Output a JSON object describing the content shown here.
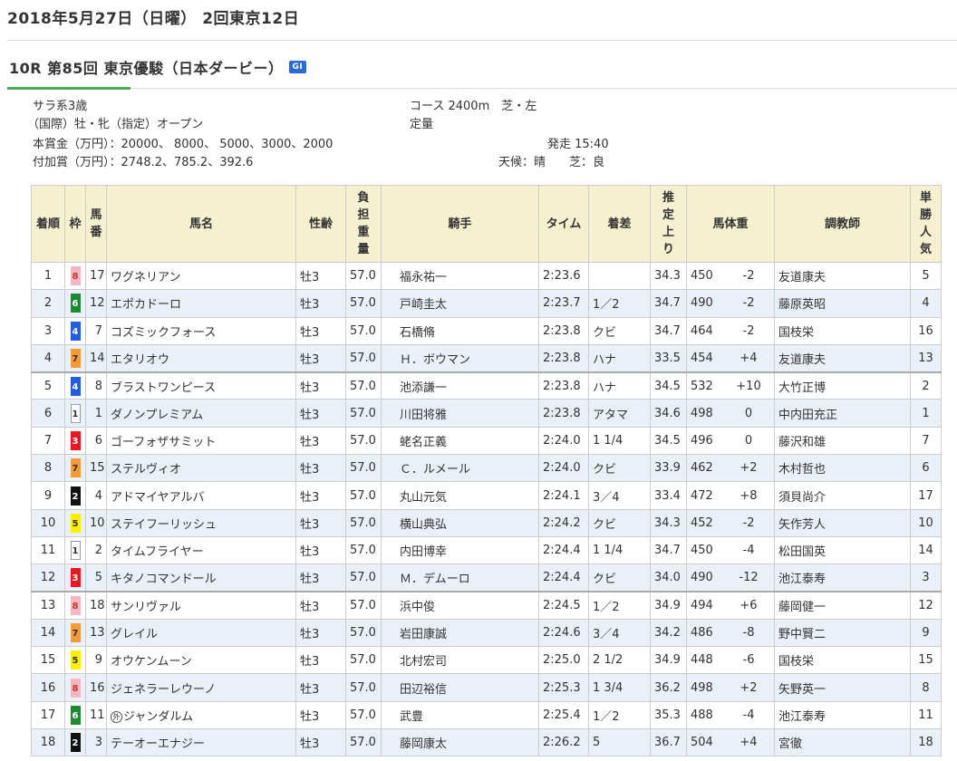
{
  "header": {
    "date_title": "2018年5月27日（日曜） 2回東京12日",
    "race_title": "10R 第85回 東京優駿（日本ダービー）",
    "grade": "GI"
  },
  "race_info": {
    "class_line": "サラ系3歳",
    "condition_line": "（国際）牡・牝（指定）オープン",
    "prize_line": "本賞金（万円）：20000、 8000、 5000、3000、2000",
    "bonus_line": "付加賞（万円）：2748.2、785.2、392.6",
    "course": "コース 2400m　芝・左",
    "weight_rule": "定量",
    "start_time": "発走 15:40",
    "weather": "天候：晴　　芝：良"
  },
  "colors": {
    "waku_1": "#ffffff",
    "waku_2": "#111111",
    "waku_3": "#e8191c",
    "waku_4": "#1f5fe0",
    "waku_5": "#ffee00",
    "waku_6": "#1c8a2e",
    "waku_7": "#f79a3a",
    "waku_8": "#f7b5c2",
    "header_bg": "#f5f0d0",
    "row_alt_bg": "#eaf0f8",
    "accent_green": "#4caf50",
    "grade_blue": "#2b6bd6"
  },
  "table": {
    "headers": {
      "rank": "着順",
      "waku": "枠",
      "umaban": "馬番",
      "horse": "馬名",
      "sexage": "性齢",
      "weight": "負担重量",
      "jockey": "騎手",
      "time": "タイム",
      "margin": "着差",
      "last3f": "推定上り",
      "body_weight": "馬体重",
      "trainer": "調教師",
      "popularity": "単勝人気"
    },
    "rows": [
      {
        "rank": "1",
        "waku": "8",
        "umaban": "17",
        "mark": "",
        "horse": "ワグネリアン",
        "sexage": "牡3",
        "weight": "57.0",
        "jockey": "福永祐一",
        "time": "2:23.6",
        "margin": "",
        "last3f": "34.3",
        "bw": "450",
        "bw_diff": "-2",
        "trainer": "友道康夫",
        "pop": "5"
      },
      {
        "rank": "2",
        "waku": "6",
        "umaban": "12",
        "mark": "",
        "horse": "エポカドーロ",
        "sexage": "牡3",
        "weight": "57.0",
        "jockey": "戸崎圭太",
        "time": "2:23.7",
        "margin": "1／2",
        "last3f": "34.7",
        "bw": "490",
        "bw_diff": "-2",
        "trainer": "藤原英昭",
        "pop": "4"
      },
      {
        "rank": "3",
        "waku": "4",
        "umaban": "7",
        "mark": "",
        "horse": "コズミックフォース",
        "sexage": "牡3",
        "weight": "57.0",
        "jockey": "石橋脩",
        "time": "2:23.8",
        "margin": "クビ",
        "last3f": "34.7",
        "bw": "464",
        "bw_diff": "-2",
        "trainer": "国枝栄",
        "pop": "16"
      },
      {
        "rank": "4",
        "waku": "7",
        "umaban": "14",
        "mark": "",
        "horse": "エタリオウ",
        "sexage": "牡3",
        "weight": "57.0",
        "jockey": "Ｈ．ボウマン",
        "time": "2:23.8",
        "margin": "ハナ",
        "last3f": "33.5",
        "bw": "454",
        "bw_diff": "+4",
        "trainer": "友道康夫",
        "pop": "13"
      },
      {
        "rank": "5",
        "waku": "4",
        "umaban": "8",
        "mark": "",
        "horse": "ブラストワンピース",
        "sexage": "牡3",
        "weight": "57.0",
        "jockey": "池添謙一",
        "time": "2:23.8",
        "margin": "ハナ",
        "last3f": "34.5",
        "bw": "532",
        "bw_diff": "+10",
        "trainer": "大竹正博",
        "pop": "2"
      },
      {
        "rank": "6",
        "waku": "1",
        "umaban": "1",
        "mark": "",
        "horse": "ダノンプレミアム",
        "sexage": "牡3",
        "weight": "57.0",
        "jockey": "川田将雅",
        "time": "2:23.8",
        "margin": "アタマ",
        "last3f": "34.6",
        "bw": "498",
        "bw_diff": "0",
        "trainer": "中内田充正",
        "pop": "1"
      },
      {
        "rank": "7",
        "waku": "3",
        "umaban": "6",
        "mark": "",
        "horse": "ゴーフォザサミット",
        "sexage": "牡3",
        "weight": "57.0",
        "jockey": "蛯名正義",
        "time": "2:24.0",
        "margin": "1 1/4",
        "last3f": "34.5",
        "bw": "496",
        "bw_diff": "0",
        "trainer": "藤沢和雄",
        "pop": "7"
      },
      {
        "rank": "8",
        "waku": "7",
        "umaban": "15",
        "mark": "",
        "horse": "ステルヴィオ",
        "sexage": "牡3",
        "weight": "57.0",
        "jockey": "Ｃ．ルメール",
        "time": "2:24.0",
        "margin": "クビ",
        "last3f": "33.9",
        "bw": "462",
        "bw_diff": "+2",
        "trainer": "木村哲也",
        "pop": "6"
      },
      {
        "rank": "9",
        "waku": "2",
        "umaban": "4",
        "mark": "",
        "horse": "アドマイヤアルバ",
        "sexage": "牡3",
        "weight": "57.0",
        "jockey": "丸山元気",
        "time": "2:24.1",
        "margin": "3／4",
        "last3f": "33.4",
        "bw": "472",
        "bw_diff": "+8",
        "trainer": "須貝尚介",
        "pop": "17"
      },
      {
        "rank": "10",
        "waku": "5",
        "umaban": "10",
        "mark": "",
        "horse": "ステイフーリッシュ",
        "sexage": "牡3",
        "weight": "57.0",
        "jockey": "横山典弘",
        "time": "2:24.2",
        "margin": "クビ",
        "last3f": "34.3",
        "bw": "452",
        "bw_diff": "-2",
        "trainer": "矢作芳人",
        "pop": "10"
      },
      {
        "rank": "11",
        "waku": "1",
        "umaban": "2",
        "mark": "",
        "horse": "タイムフライヤー",
        "sexage": "牡3",
        "weight": "57.0",
        "jockey": "内田博幸",
        "time": "2:24.4",
        "margin": "1 1/4",
        "last3f": "34.7",
        "bw": "450",
        "bw_diff": "-4",
        "trainer": "松田国英",
        "pop": "14"
      },
      {
        "rank": "12",
        "waku": "3",
        "umaban": "5",
        "mark": "",
        "horse": "キタノコマンドール",
        "sexage": "牡3",
        "weight": "57.0",
        "jockey": "Ｍ．デムーロ",
        "time": "2:24.4",
        "margin": "クビ",
        "last3f": "34.0",
        "bw": "490",
        "bw_diff": "-12",
        "trainer": "池江泰寿",
        "pop": "3"
      },
      {
        "rank": "13",
        "waku": "8",
        "umaban": "18",
        "mark": "",
        "horse": "サンリヴァル",
        "sexage": "牡3",
        "weight": "57.0",
        "jockey": "浜中俊",
        "time": "2:24.5",
        "margin": "1／2",
        "last3f": "34.9",
        "bw": "494",
        "bw_diff": "+6",
        "trainer": "藤岡健一",
        "pop": "12"
      },
      {
        "rank": "14",
        "waku": "7",
        "umaban": "13",
        "mark": "",
        "horse": "グレイル",
        "sexage": "牡3",
        "weight": "57.0",
        "jockey": "岩田康誠",
        "time": "2:24.6",
        "margin": "3／4",
        "last3f": "34.2",
        "bw": "486",
        "bw_diff": "-8",
        "trainer": "野中賢二",
        "pop": "9"
      },
      {
        "rank": "15",
        "waku": "5",
        "umaban": "9",
        "mark": "",
        "horse": "オウケンムーン",
        "sexage": "牡3",
        "weight": "57.0",
        "jockey": "北村宏司",
        "time": "2:25.0",
        "margin": "2 1/2",
        "last3f": "34.9",
        "bw": "448",
        "bw_diff": "-6",
        "trainer": "国枝栄",
        "pop": "15"
      },
      {
        "rank": "16",
        "waku": "8",
        "umaban": "16",
        "mark": "",
        "horse": "ジェネラーレウーノ",
        "sexage": "牡3",
        "weight": "57.0",
        "jockey": "田辺裕信",
        "time": "2:25.3",
        "margin": "1 3/4",
        "last3f": "36.2",
        "bw": "498",
        "bw_diff": "+2",
        "trainer": "矢野英一",
        "pop": "8"
      },
      {
        "rank": "17",
        "waku": "6",
        "umaban": "11",
        "mark": "外",
        "horse": "ジャンダルム",
        "sexage": "牡3",
        "weight": "57.0",
        "jockey": "武豊",
        "time": "2:25.4",
        "margin": "1／2",
        "last3f": "35.3",
        "bw": "488",
        "bw_diff": "-4",
        "trainer": "池江泰寿",
        "pop": "11"
      },
      {
        "rank": "18",
        "waku": "2",
        "umaban": "3",
        "mark": "",
        "horse": "テーオーエナジー",
        "sexage": "牡3",
        "weight": "57.0",
        "jockey": "藤岡康太",
        "time": "2:26.2",
        "margin": "5",
        "last3f": "36.7",
        "bw": "504",
        "bw_diff": "+4",
        "trainer": "宮徹",
        "pop": "18"
      }
    ]
  }
}
